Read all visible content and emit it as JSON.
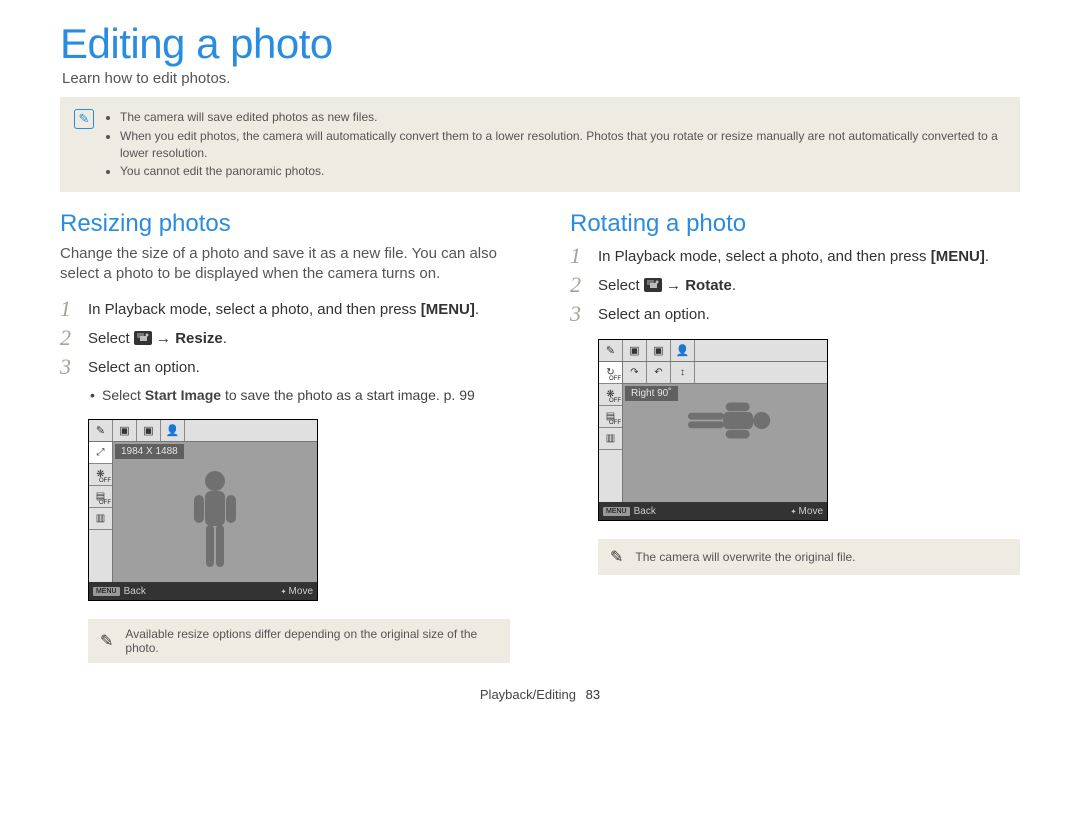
{
  "title": "Editing a photo",
  "subtitle": "Learn how to edit photos.",
  "pen_icon": "✎",
  "top_notes": [
    "The camera will save edited photos as new files.",
    "When you edit photos, the camera will automatically convert them to a lower resolution. Photos that you rotate or resize manually are not automatically converted to a lower resolution.",
    "You cannot edit the panoramic photos."
  ],
  "left": {
    "heading": "Resizing photos",
    "description": "Change the size of a photo and save it as a new file. You can also select a photo to be displayed when the camera turns on.",
    "step1_text": "In Playback mode, select a photo, and then press ",
    "menu_label": "[MENU]",
    "step2_a": "Select ",
    "step2_arrow": " → ",
    "step2_action": "Resize",
    "step3": "Select an option.",
    "sub_a": "Select ",
    "sub_b": "Start Image",
    "sub_c": " to save the photo as a start image. p. 99",
    "screen_label": "1984 X 1488",
    "back_label": "Back",
    "move_label": "Move",
    "bmenu": "MENU",
    "note": "Available resize options differ depending on the original size of the photo."
  },
  "right": {
    "heading": "Rotating a photo",
    "step1_text": "In Playback mode, select a photo, and then press ",
    "menu_label": "[MENU]",
    "step2_a": "Select ",
    "step2_arrow": " → ",
    "step2_action": "Rotate",
    "step3": "Select an option.",
    "screen_label": "Right 90˚",
    "back_label": "Back",
    "move_label": "Move",
    "bmenu": "MENU",
    "note": "The camera will overwrite the original file."
  },
  "icons": {
    "edit": "✎",
    "resize": "⤢",
    "rotate": "↻",
    "frame": "▣",
    "person": "👤",
    "off_tag": "OFF",
    "back_arrow": "↶",
    "fwd_arrow": "↷",
    "menu_small": "≡"
  },
  "footer_section": "Playback/Editing",
  "footer_page": "83"
}
